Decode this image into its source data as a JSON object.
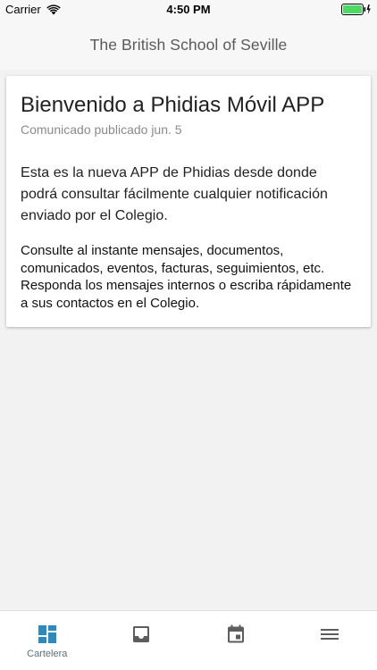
{
  "status_bar": {
    "carrier": "Carrier",
    "time": "4:50 PM",
    "battery_color": "#4cd964"
  },
  "header": {
    "title": "The British School of Seville"
  },
  "card": {
    "title": "Bienvenido a Phidias Móvil APP",
    "subtitle": "Comunicado publicado jun. 5",
    "intro": "Esta es la nueva APP de Phidias desde donde podrá consultar fácilmente cualquier notificación enviado por el Colegio.",
    "details": "Consulte al instante mensajes, documentos, comunicados, eventos, facturas, seguimientos, etc. Responda los mensajes internos o escriba rápidamente a sus contactos en el Colegio."
  },
  "tab_bar": {
    "active_color": "#2b8bbf",
    "inactive_color": "#5d5d5d",
    "tabs": [
      {
        "label": "Cartelera",
        "icon": "dashboard-icon",
        "active": true
      },
      {
        "label": "",
        "icon": "inbox-icon",
        "active": false
      },
      {
        "label": "",
        "icon": "calendar-icon",
        "active": false
      },
      {
        "label": "",
        "icon": "menu-icon",
        "active": false
      }
    ]
  }
}
